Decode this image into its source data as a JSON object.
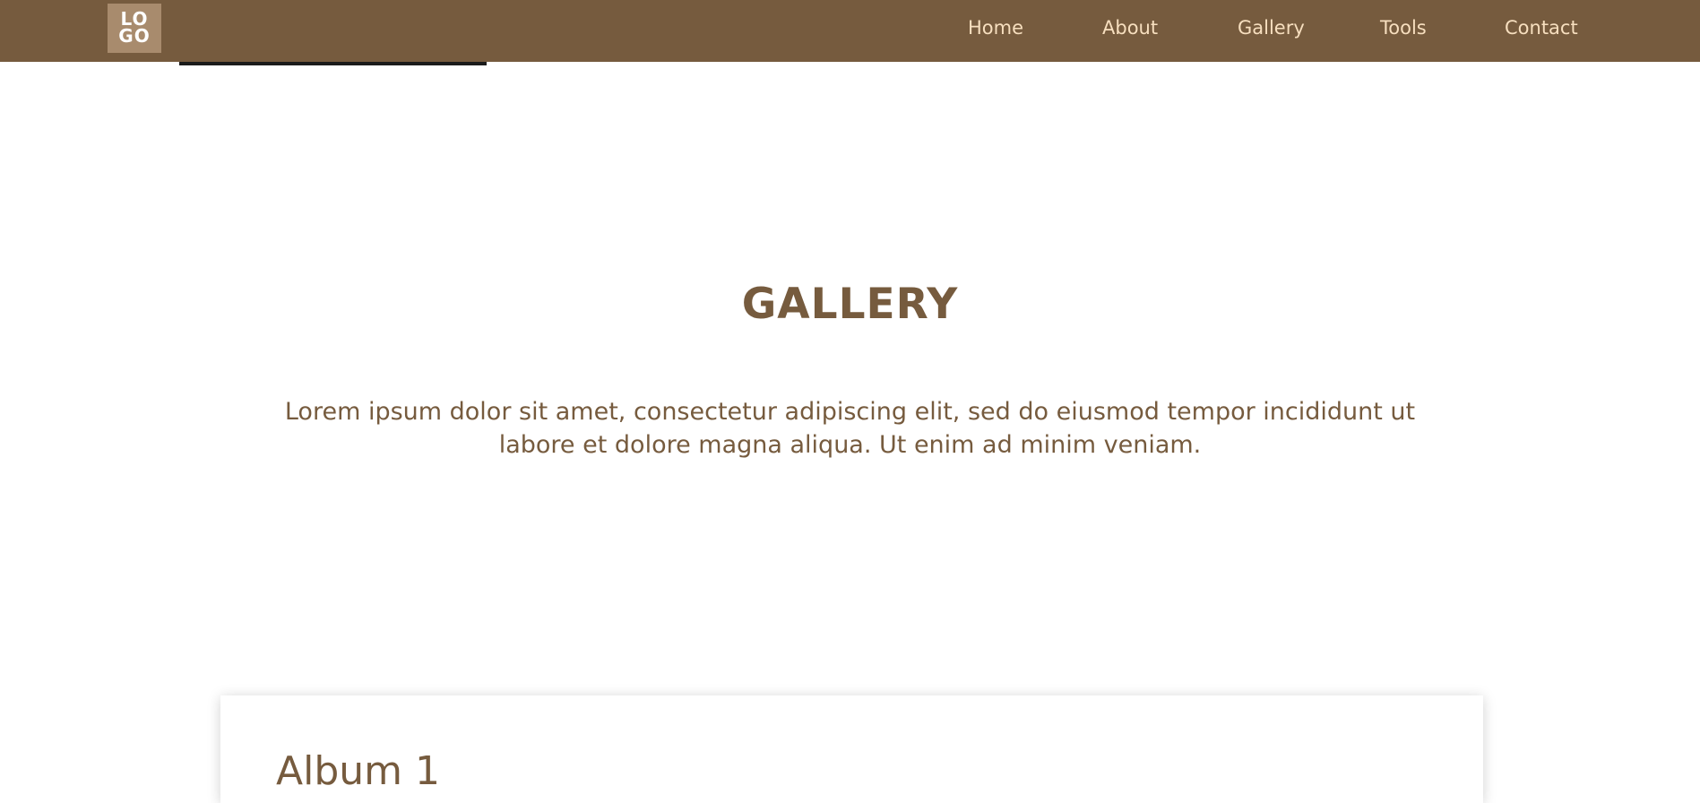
{
  "header": {
    "logo": {
      "line1": "LO",
      "line2": "GO"
    },
    "nav": {
      "home": "Home",
      "about": "About",
      "gallery": "Gallery",
      "tools": "Tools",
      "contact": "Contact"
    }
  },
  "main": {
    "title": "GALLERY",
    "intro": "Lorem ipsum dolor sit amet, consectetur adipiscing elit, sed do eiusmod tempor incididunt ut labore et dolore magna aliqua. Ut enim ad minim veniam.",
    "albums": [
      {
        "title": "Album 1"
      }
    ]
  },
  "colors": {
    "brand": "#765b3e",
    "logo_bg": "#a88b6d",
    "nav_text": "#f7dfbf",
    "page_bg": "#ffffff"
  }
}
